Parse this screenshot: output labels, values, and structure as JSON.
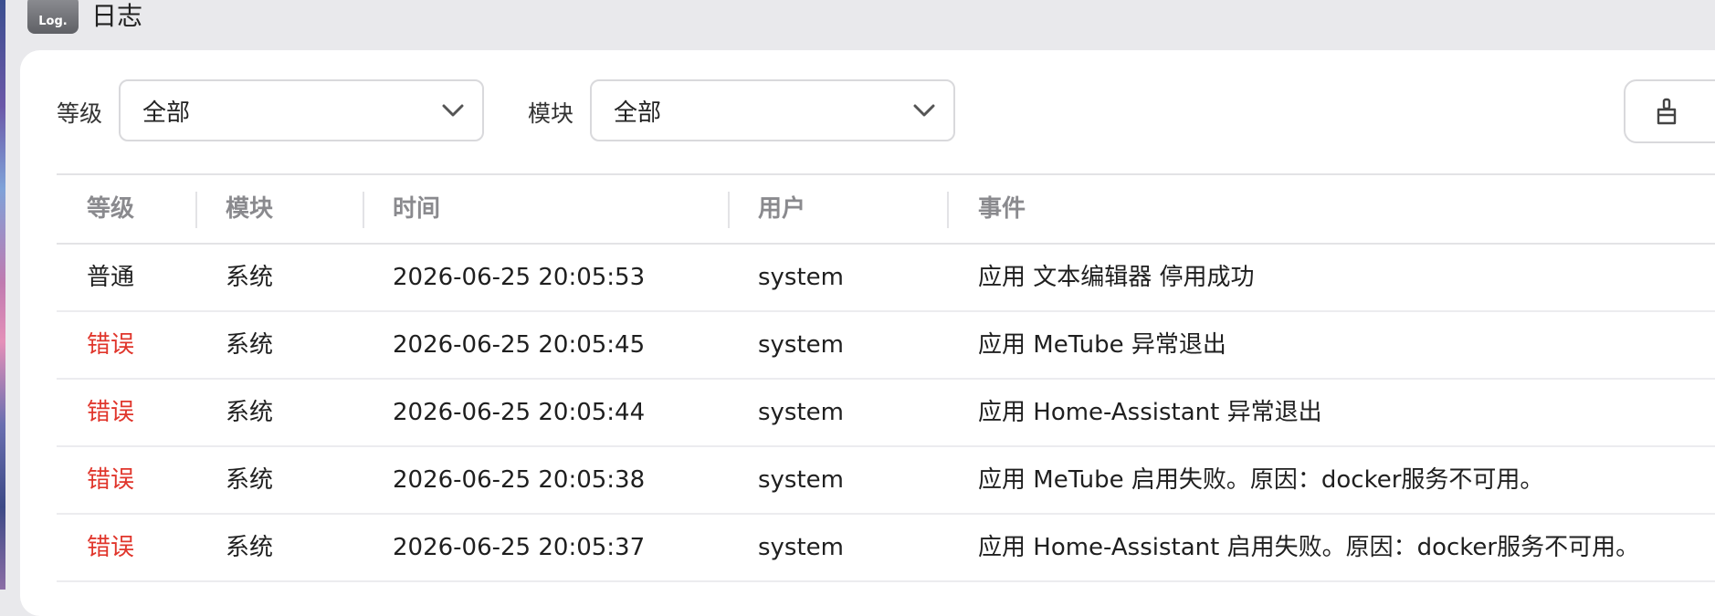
{
  "app": {
    "icon_text": "Log.",
    "title": "日志"
  },
  "filters": {
    "level": {
      "label": "等级",
      "value": "全部"
    },
    "module": {
      "label": "模块",
      "value": "全部"
    }
  },
  "actions": {
    "clean_icon": "broom-icon"
  },
  "colors": {
    "error": "#e0352b",
    "normal": "#1f1f1f"
  },
  "table": {
    "columns": [
      "等级",
      "模块",
      "时间",
      "用户",
      "事件"
    ],
    "rows": [
      {
        "level": "普通",
        "level_type": "normal",
        "module": "系统",
        "time": "2026-06-25 20:05:53",
        "user": "system",
        "event": "应用 文本编辑器 停用成功"
      },
      {
        "level": "错误",
        "level_type": "error",
        "module": "系统",
        "time": "2026-06-25 20:05:45",
        "user": "system",
        "event": "应用 MeTube 异常退出"
      },
      {
        "level": "错误",
        "level_type": "error",
        "module": "系统",
        "time": "2026-06-25 20:05:44",
        "user": "system",
        "event": "应用 Home-Assistant 异常退出"
      },
      {
        "level": "错误",
        "level_type": "error",
        "module": "系统",
        "time": "2026-06-25 20:05:38",
        "user": "system",
        "event": "应用 MeTube 启用失败。原因：docker服务不可用。"
      },
      {
        "level": "错误",
        "level_type": "error",
        "module": "系统",
        "time": "2026-06-25 20:05:37",
        "user": "system",
        "event": "应用 Home-Assistant 启用失败。原因：docker服务不可用。"
      }
    ]
  }
}
